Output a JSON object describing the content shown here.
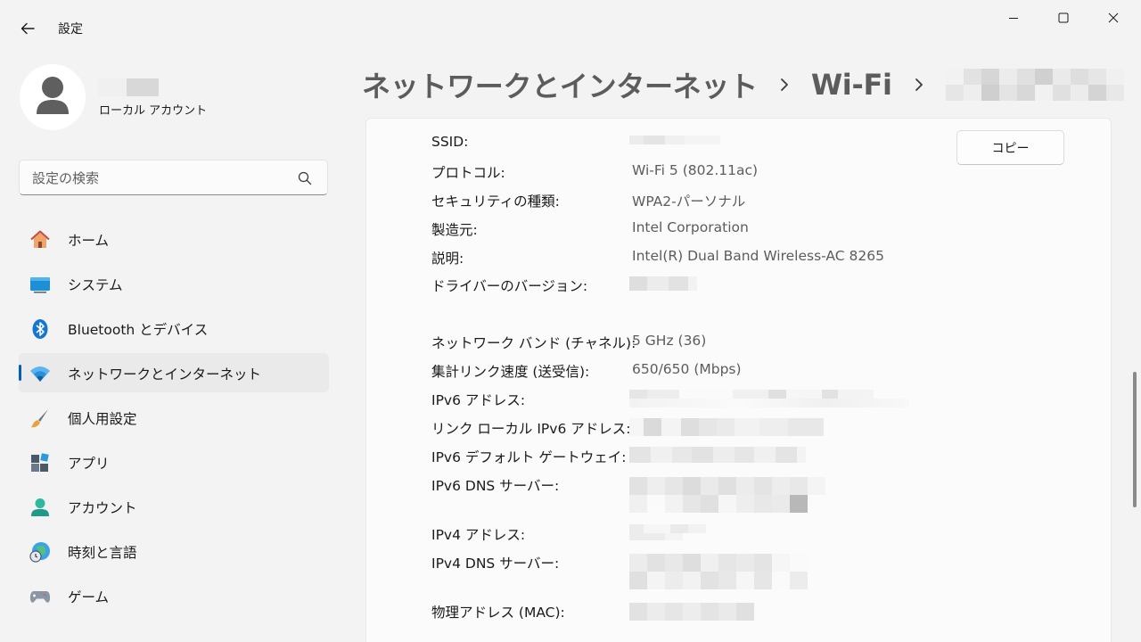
{
  "window": {
    "title": "設定",
    "controls": [
      "minimize-icon",
      "maximize-icon",
      "close-icon"
    ]
  },
  "profile": {
    "account_type": "ローカル アカウント"
  },
  "search": {
    "placeholder": "設定の検索",
    "icon": "search-icon"
  },
  "nav": {
    "items": [
      {
        "label": "ホーム",
        "icon": "home-icon"
      },
      {
        "label": "システム",
        "icon": "system-icon"
      },
      {
        "label": "Bluetooth とデバイス",
        "icon": "bluetooth-icon"
      },
      {
        "label": "ネットワークとインターネット",
        "icon": "wifi-icon",
        "active": true
      },
      {
        "label": "個人用設定",
        "icon": "brush-icon"
      },
      {
        "label": "アプリ",
        "icon": "apps-icon"
      },
      {
        "label": "アカウント",
        "icon": "account-icon"
      },
      {
        "label": "時刻と言語",
        "icon": "globe-clock-icon"
      },
      {
        "label": "ゲーム",
        "icon": "gamepad-icon"
      }
    ]
  },
  "breadcrumb": {
    "items": [
      "ネットワークとインターネット",
      "Wi-Fi"
    ]
  },
  "details": {
    "copy_label": "コピー",
    "ssid_label": "SSID:",
    "protocol_label": "プロトコル:",
    "protocol_value": "Wi-Fi 5 (802.11ac)",
    "security_label": "セキュリティの種類:",
    "security_value": "WPA2-パーソナル",
    "manufacturer_label": "製造元:",
    "manufacturer_value": "Intel Corporation",
    "description_label": "説明:",
    "description_value": "Intel(R) Dual Band Wireless-AC 8265",
    "driver_label": "ドライバーのバージョン:",
    "band_label": "ネットワーク バンド (チャネル):",
    "band_value": "5 GHz (36)",
    "speed_label": "集計リンク速度 (送受信):",
    "speed_value": "650/650 (Mbps)",
    "ipv6_label": "IPv6 アドレス:",
    "link_local_label": "リンク ローカル IPv6 アドレス:",
    "ipv6_gateway_label": "IPv6 デフォルト ゲートウェイ:",
    "ipv6_dns_label": "IPv6 DNS サーバー:",
    "ipv4_label": "IPv4 アドレス:",
    "ipv4_dns_label": "IPv4 DNS サーバー:",
    "mac_label": "物理アドレス (MAC):"
  },
  "colors": {
    "accent": "#005fb8",
    "window_bg": "#f3f3f3",
    "card_bg": "#fbfbfb",
    "value_text": "#5c5c5c"
  }
}
